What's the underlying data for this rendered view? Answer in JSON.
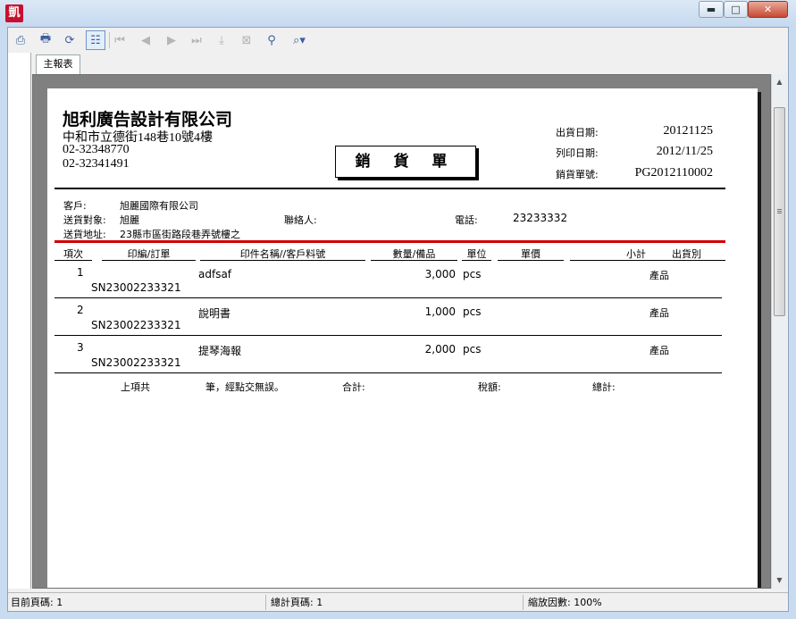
{
  "window": {
    "app_icon_glyph": "凱",
    "minimize_glyph": "▬",
    "maximize_glyph": "□",
    "close_glyph": "✕"
  },
  "toolbar": {
    "icons": [
      "export-icon",
      "print-icon",
      "refresh-icon",
      "group-tree-icon",
      "first-page-icon",
      "previous-page-icon",
      "next-page-icon",
      "last-page-icon",
      "goto-page-icon",
      "stop-icon",
      "find-icon",
      "zoom-icon"
    ],
    "glyphs": {
      "export": "⎙",
      "print": "🖶",
      "refresh": "⟳",
      "group_tree": "☷",
      "first": "⏮",
      "previous": "◀",
      "next": "▶",
      "last": "⏭",
      "goto": "⤓",
      "stop": "⊠",
      "find": "⚲",
      "zoom": "⌕▾"
    }
  },
  "tabs": [
    {
      "label": "主報表"
    }
  ],
  "report": {
    "company": {
      "name": "旭利廣告設計有限公司",
      "address": "中和市立德街148巷10號4樓",
      "phone": "02-32348770",
      "fax": "02-32341491"
    },
    "doc_title": "銷 貨 單",
    "meta": {
      "ship_date_label": "出貨日期:",
      "ship_date": "20121125",
      "print_date_label": "列印日期:",
      "print_date": "2012/11/25",
      "order_no_label": "銷貨單號:",
      "order_no": "PG2012110002"
    },
    "customer": {
      "customer_label": "客戶:",
      "customer": "旭麗國際有限公司",
      "ship_to_label": "送貨對象:",
      "ship_to": "旭麗",
      "contact_label": "聯絡人:",
      "contact": "",
      "phone_label": "電話:",
      "phone": "23233332",
      "address_label": "送貨地址:",
      "address": "23縣市區街路段巷弄號樓之"
    },
    "columns": [
      "項次",
      "印編/訂單",
      "印件名稱//客戶料號",
      "數量/備品",
      "單位",
      "單價",
      "小計",
      "出貨別"
    ],
    "rows": [
      {
        "index": "1",
        "order": "SN23002233321",
        "name": "adfsaf",
        "qty": "3,000",
        "unit": "pcs",
        "price": "",
        "subtotal": "",
        "ship_type": "產品"
      },
      {
        "index": "2",
        "order": "SN23002233321",
        "name": "說明書",
        "qty": "1,000",
        "unit": "pcs",
        "price": "",
        "subtotal": "",
        "ship_type": "產品"
      },
      {
        "index": "3",
        "order": "SN23002233321",
        "name": "提琴海報",
        "qty": "2,000",
        "unit": "pcs",
        "price": "",
        "subtotal": "",
        "ship_type": "產品"
      }
    ],
    "footer": {
      "items_prefix": "上項共",
      "items_suffix": "筆，經點交無誤。",
      "sum_label": "合計:",
      "tax_label": "稅額:",
      "total_label": "總計:"
    }
  },
  "statusbar": {
    "current_page": "目前頁碼: 1",
    "total_pages": "總計頁碼: 1",
    "zoom": "縮放因數: 100%"
  }
}
